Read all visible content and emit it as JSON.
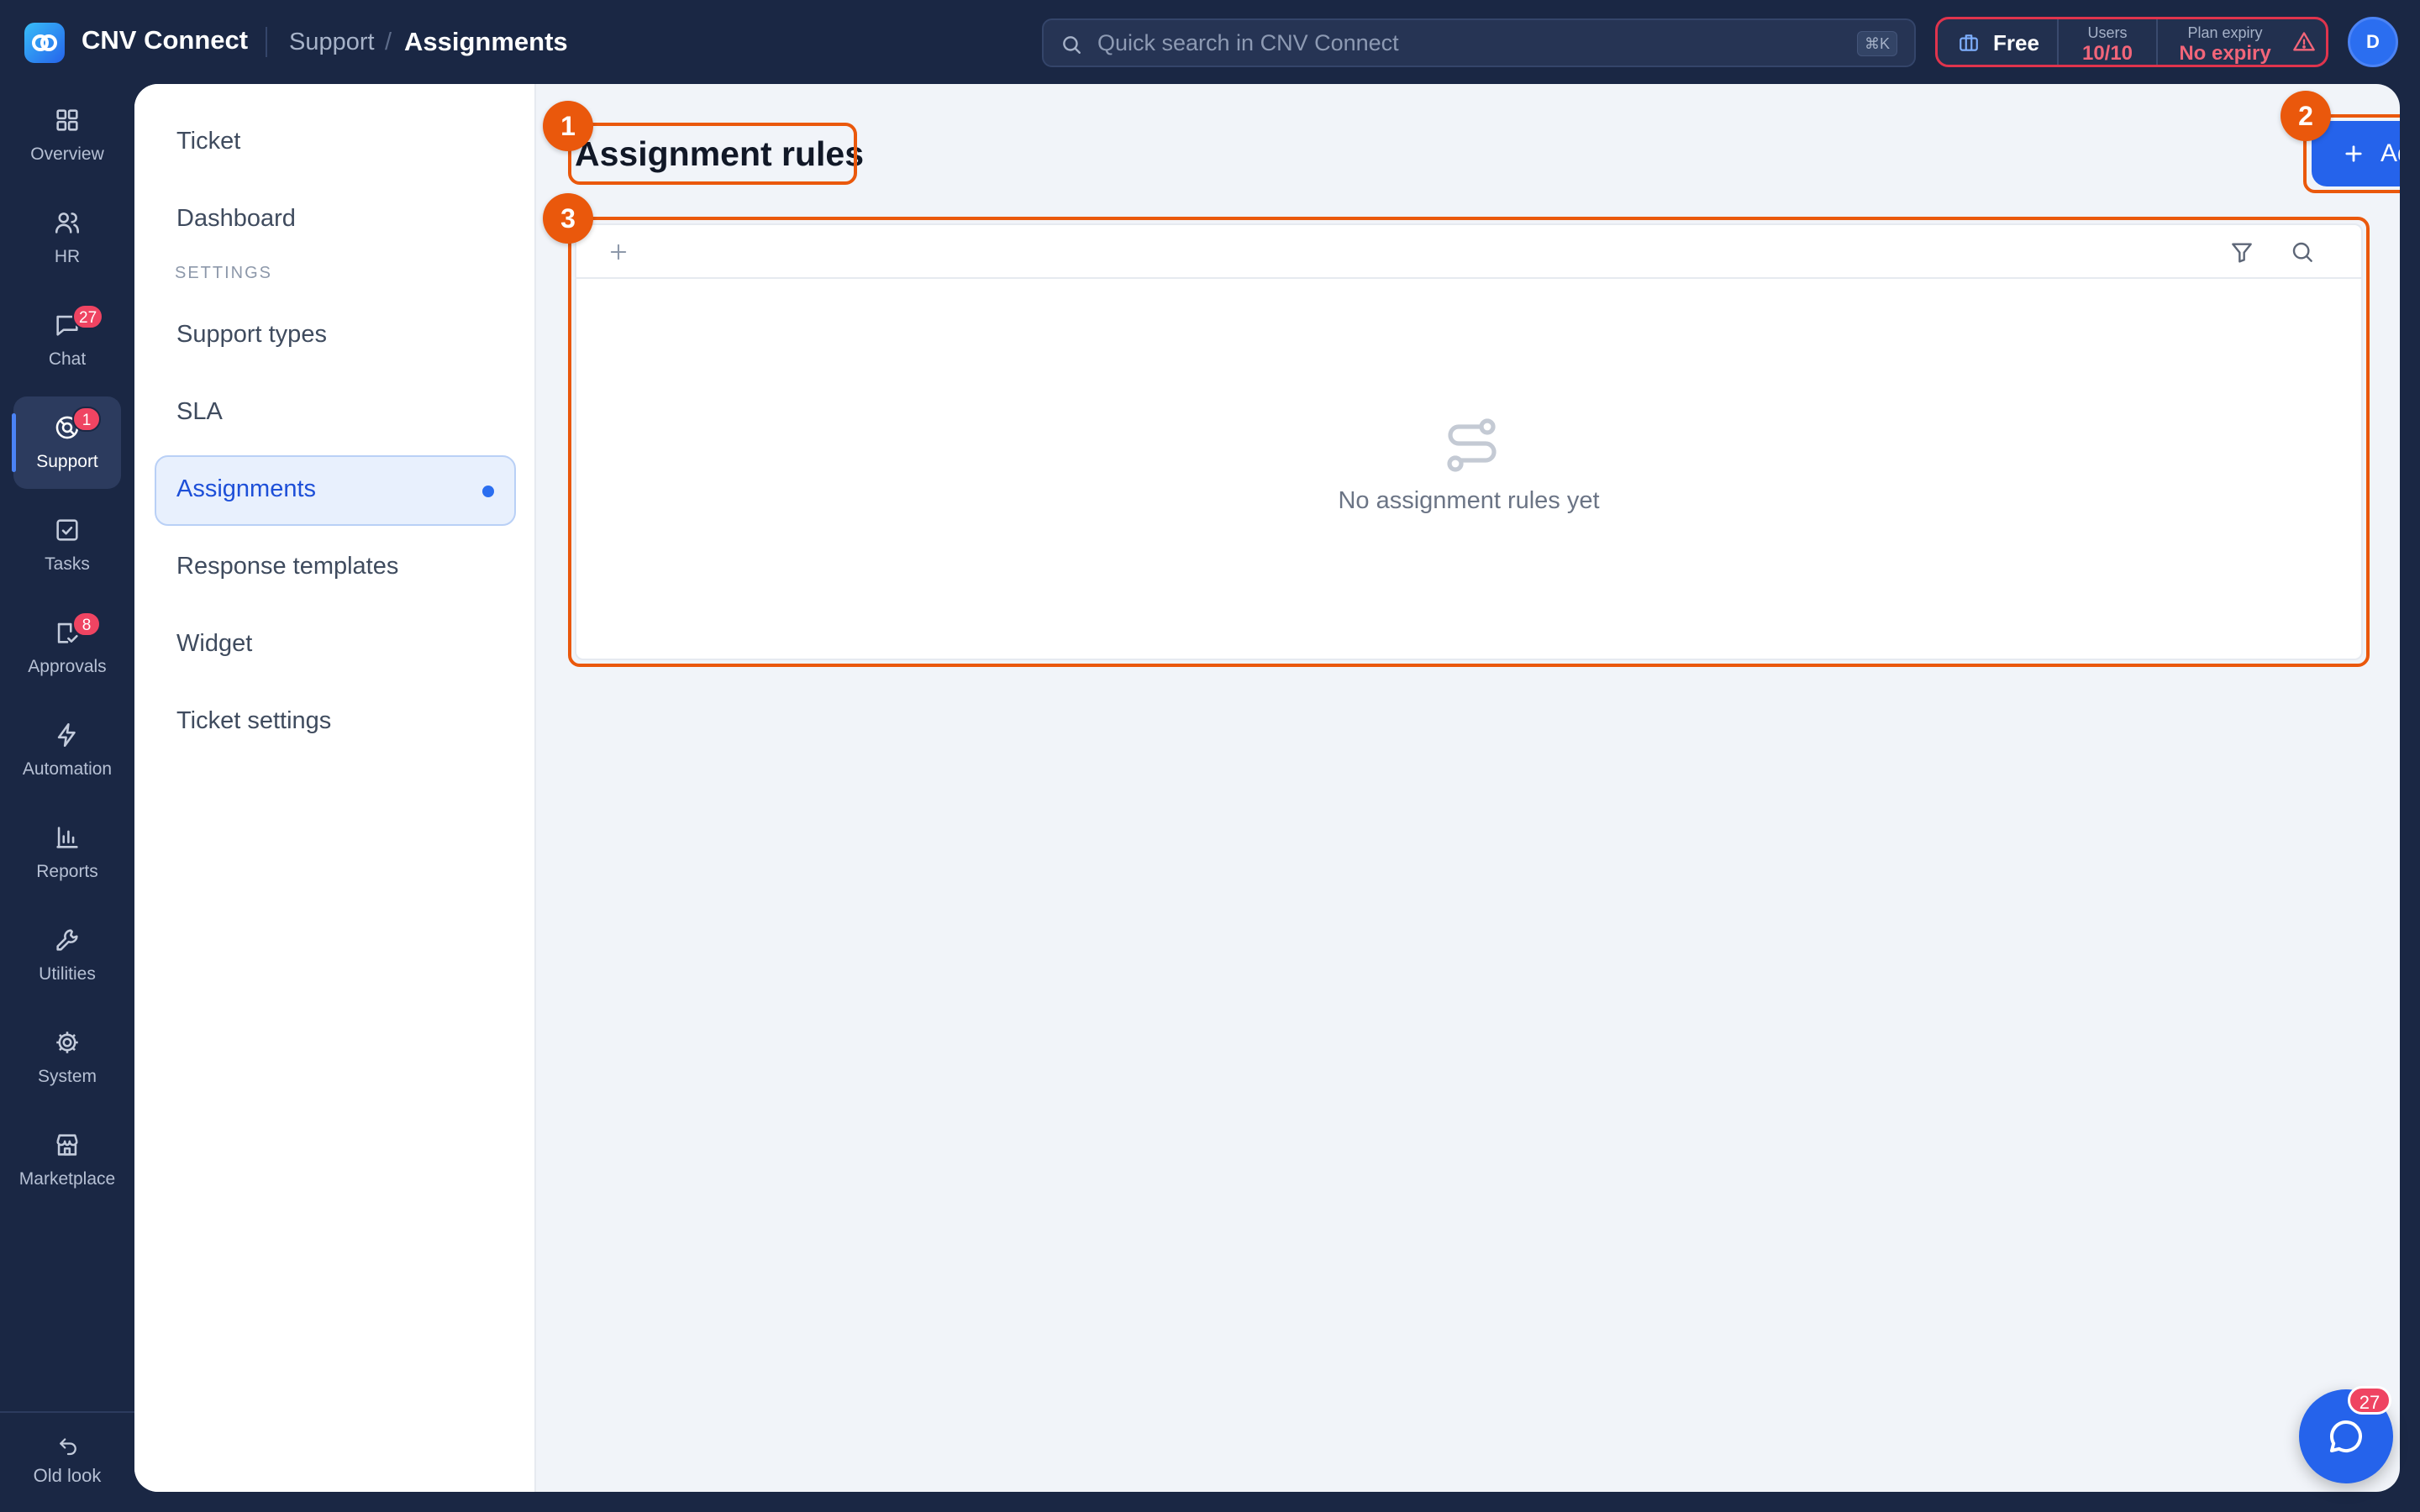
{
  "app": {
    "name": "CNV Connect"
  },
  "breadcrumb": {
    "parent": "Support",
    "separator": "/",
    "current": "Assignments"
  },
  "search": {
    "placeholder": "Quick search in CNV Connect",
    "shortcut": "⌘K"
  },
  "plan": {
    "tier": "Free",
    "users_label": "Users",
    "users_value": "10/10",
    "expiry_label": "Plan expiry",
    "expiry_value": "No expiry"
  },
  "user": {
    "initial": "D"
  },
  "rail": {
    "items": [
      {
        "label": "Overview",
        "icon": "grid-icon"
      },
      {
        "label": "HR",
        "icon": "users-icon"
      },
      {
        "label": "Chat",
        "icon": "chat-icon",
        "badge": "27"
      },
      {
        "label": "Support",
        "icon": "lifebuoy-icon",
        "badge": "1",
        "active": true
      },
      {
        "label": "Tasks",
        "icon": "checkbox-icon"
      },
      {
        "label": "Approvals",
        "icon": "approval-icon",
        "badge": "8"
      },
      {
        "label": "Automation",
        "icon": "bolt-icon"
      },
      {
        "label": "Reports",
        "icon": "bar-chart-icon"
      },
      {
        "label": "Utilities",
        "icon": "wrench-icon"
      },
      {
        "label": "System",
        "icon": "gear-icon"
      },
      {
        "label": "Marketplace",
        "icon": "store-icon"
      }
    ],
    "old_look": "Old look"
  },
  "subnav": {
    "items_top": [
      "Ticket",
      "Dashboard"
    ],
    "section_label": "SETTINGS",
    "items_settings": [
      "Support types",
      "SLA",
      "Assignments",
      "Response templates",
      "Widget",
      "Ticket settings"
    ],
    "active": "Assignments"
  },
  "main": {
    "title": "Assignment rules",
    "add_button": "Add rule",
    "empty_text": "No assignment rules yet"
  },
  "annotations": [
    "1",
    "2",
    "3"
  ],
  "chat_fab": {
    "badge": "27"
  },
  "colors": {
    "navy": "#1a2744",
    "accent": "#2563eb",
    "annotation": "#ea580c",
    "badge": "#ef4462"
  }
}
